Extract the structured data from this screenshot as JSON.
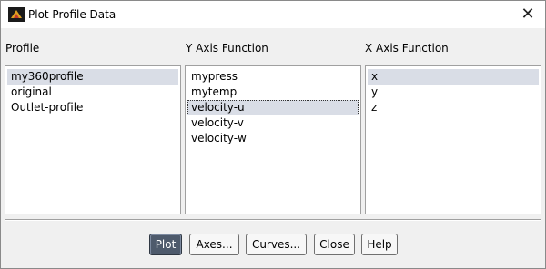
{
  "window": {
    "title": "Plot Profile Data",
    "close_glyph": "✕"
  },
  "profile": {
    "label": "Profile",
    "items": [
      "my360profile",
      "original",
      "Outlet-profile"
    ],
    "selected": "my360profile"
  },
  "y_axis": {
    "label": "Y Axis Function",
    "items": [
      "mypress",
      "mytemp",
      "velocity-u",
      "velocity-v",
      "velocity-w"
    ],
    "selected": "velocity-u"
  },
  "x_axis": {
    "label": "X Axis Function",
    "items": [
      "x",
      "y",
      "z"
    ],
    "selected": "x"
  },
  "buttons": {
    "plot": "Plot",
    "axes": "Axes...",
    "curves": "Curves...",
    "close": "Close",
    "help": "Help"
  },
  "icons": {
    "app": "fluent-app-icon",
    "close": "close-icon"
  },
  "colors": {
    "selection": "#d9dde6",
    "default_button": "#4e5a6c"
  }
}
